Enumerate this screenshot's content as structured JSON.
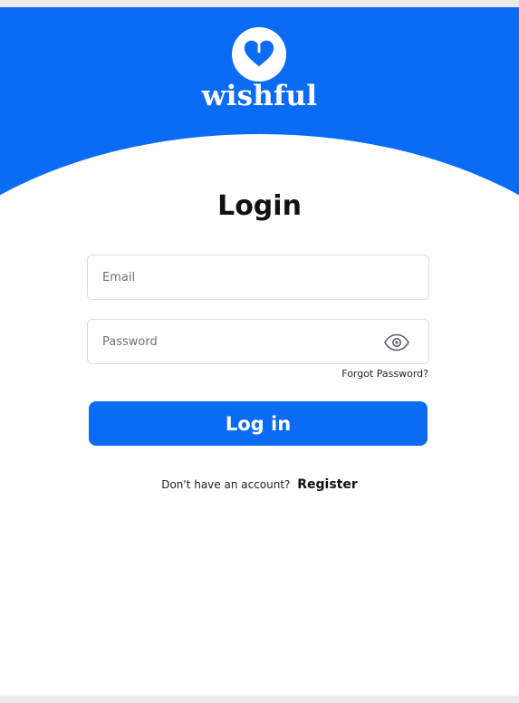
{
  "brand": {
    "name": "wishful",
    "logo_icon": "heart-icon",
    "primary_color": "#0a6cf5"
  },
  "login": {
    "title": "Login",
    "email_placeholder": "Email",
    "password_placeholder": "Password",
    "password_toggle_icon": "eye-icon",
    "forgot_password": "Forgot Password?",
    "submit_label": "Log in",
    "no_account_text": "Don't have an account?",
    "register_label": "Register"
  }
}
